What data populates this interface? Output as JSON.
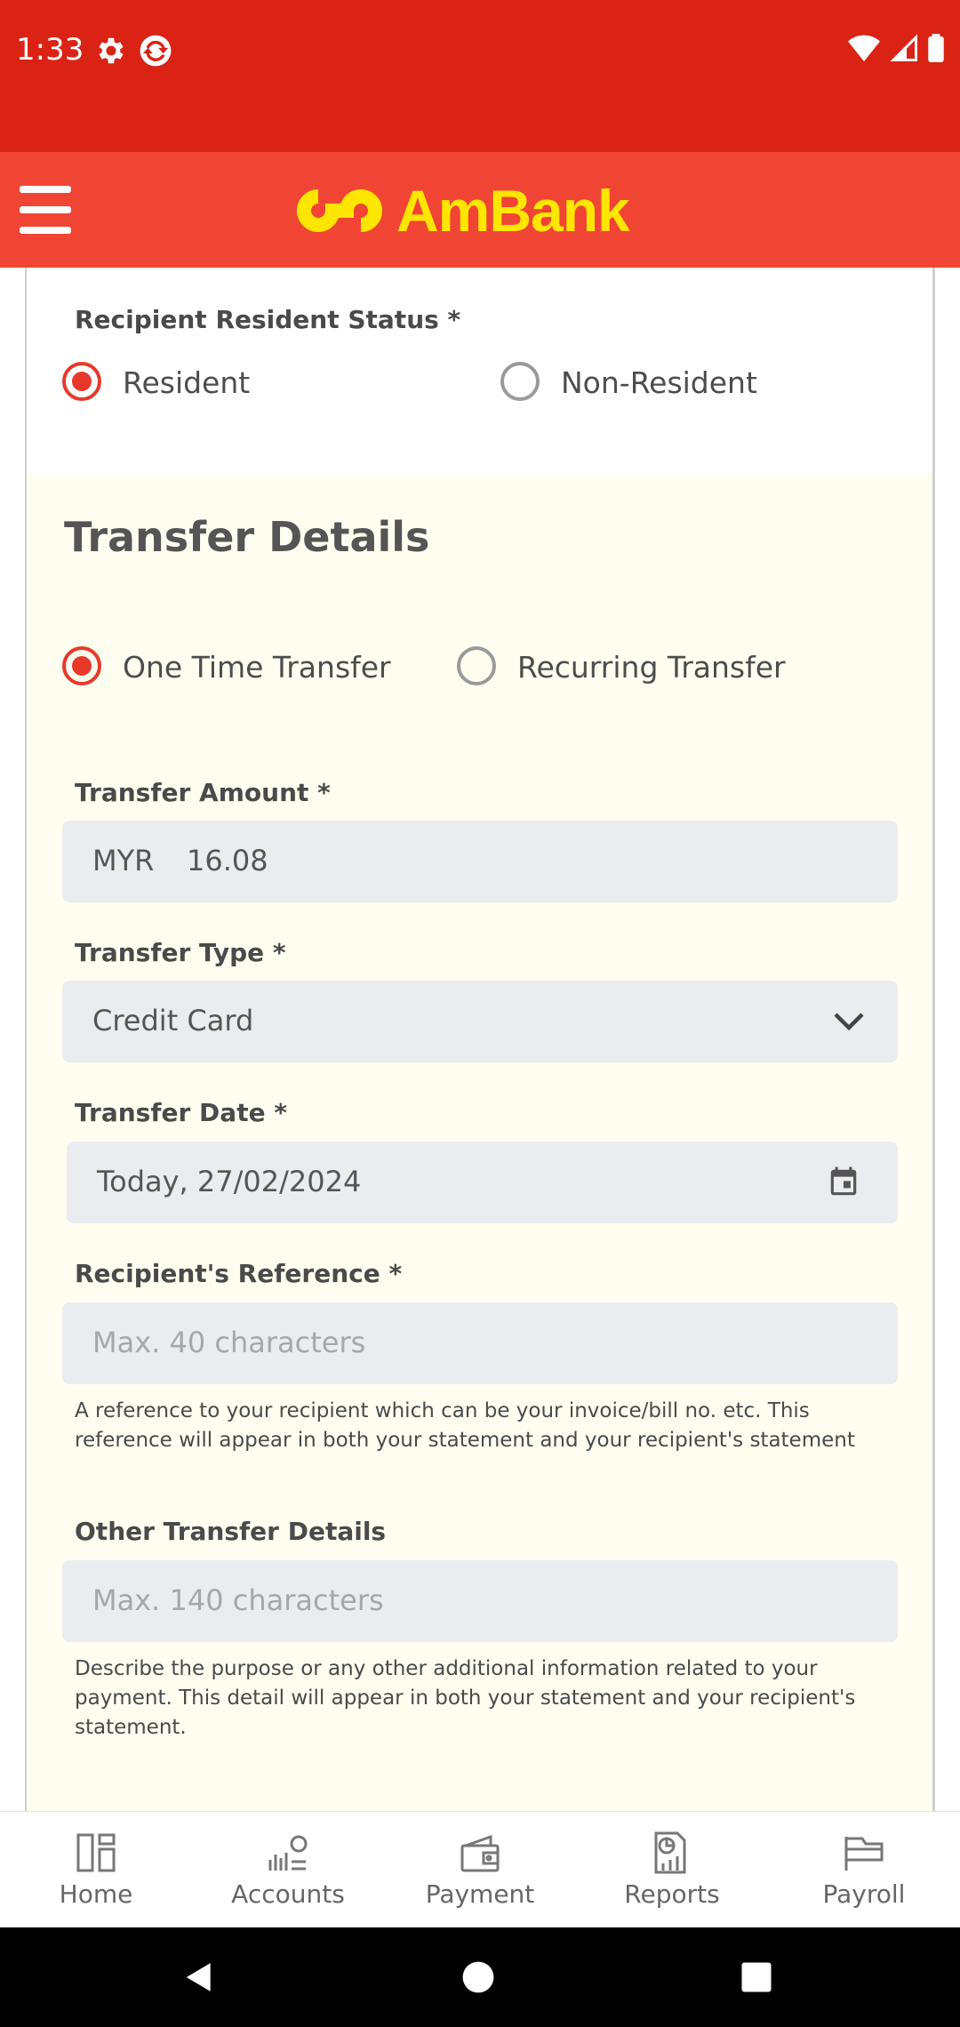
{
  "status_bar": {
    "time": "1:33"
  },
  "header": {
    "brand": "AmBank"
  },
  "resident_status": {
    "label": "Recipient Resident Status *",
    "options": [
      {
        "label": "Resident",
        "selected": true
      },
      {
        "label": "Non-Resident",
        "selected": false
      }
    ]
  },
  "transfer_details": {
    "title": "Transfer Details",
    "frequency_options": [
      {
        "label": "One Time Transfer",
        "selected": true
      },
      {
        "label": "Recurring Transfer",
        "selected": false
      }
    ],
    "amount": {
      "label": "Transfer Amount *",
      "currency": "MYR",
      "value": "16.08"
    },
    "type": {
      "label": "Transfer Type *",
      "value": "Credit Card"
    },
    "date": {
      "label": "Transfer Date *",
      "value": "Today, 27/02/2024"
    },
    "reference": {
      "label": "Recipient's Reference *",
      "placeholder": "Max. 40 characters",
      "helper": "A reference to your recipient which can be your invoice/bill no. etc. This reference will appear in both your statement and your recipient's statement"
    },
    "other": {
      "label": "Other Transfer Details",
      "placeholder": "Max. 140 characters",
      "helper": "Describe the purpose or any other additional information related to your payment. This detail will appear in both your statement and your recipient's statement."
    }
  },
  "bottom_nav": {
    "items": [
      {
        "label": "Home",
        "icon": "home-icon"
      },
      {
        "label": "Accounts",
        "icon": "accounts-icon"
      },
      {
        "label": "Payment",
        "icon": "wallet-icon"
      },
      {
        "label": "Reports",
        "icon": "reports-icon"
      },
      {
        "label": "Payroll",
        "icon": "folder-icon"
      }
    ]
  },
  "colors": {
    "status_bar": "#da2314",
    "header": "#f04535",
    "brand_yellow": "#ffe600",
    "radio_active": "#e8382a",
    "details_bg": "#fefef0",
    "field_bg": "#ebecf0"
  }
}
